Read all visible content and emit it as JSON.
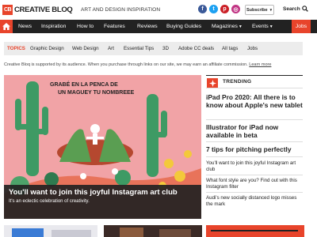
{
  "header": {
    "logo_mark": "CB",
    "logo_text": "CREATIVE BLOQ",
    "tagline": "ART AND DESIGN INSPIRATION",
    "social": [
      {
        "icon": "facebook-icon",
        "glyph": "f",
        "color": "#3b5998"
      },
      {
        "icon": "twitter-icon",
        "glyph": "t",
        "color": "#1da1f2"
      },
      {
        "icon": "pinterest-icon",
        "glyph": "p",
        "color": "#cb2027"
      },
      {
        "icon": "instagram-icon",
        "glyph": "◎",
        "color": "#c13584"
      }
    ],
    "subscribe_label": "Subscribe",
    "search_label": "Search"
  },
  "nav": {
    "items": [
      "News",
      "Inspiration",
      "How to",
      "Features",
      "Reviews",
      "Buying Guides",
      "Magazines",
      "Events"
    ],
    "jobs_label": "Jobs"
  },
  "topics": {
    "heading": "TOPICS",
    "items": [
      "Graphic Design",
      "Web Design",
      "Art",
      "Essential Tips",
      "3D",
      "Adobe CC deals",
      "All tags",
      "Jobs"
    ]
  },
  "disclaimer": {
    "text": "Creative Bloq is supported by its audience. When you purchase through links on our site, we may earn an affiliate commission.",
    "link": "Learn more"
  },
  "hero": {
    "image_text_line1": "GRABÉ EN LA PENCA DE",
    "image_text_line2": "UN MAGUEY TU NOMBREEE",
    "title": "You'll want to join this joyful Instagram art club",
    "strap": "It's an eclectic celebration of creativity."
  },
  "trending": {
    "heading": "TRENDING",
    "big": [
      "iPad Pro 2020: All there is to know about Apple's new tablet",
      "Illustrator for iPad now available in beta",
      "7 tips for pitching perfectly"
    ],
    "small": [
      "You'll want to join this joyful Instagram art club",
      "What font style are you? Find out with this Instagram filter",
      "Audi's new socially distanced logo misses the mark"
    ]
  },
  "colors": {
    "brand": "#e8442b",
    "nav_bg": "#222222"
  }
}
